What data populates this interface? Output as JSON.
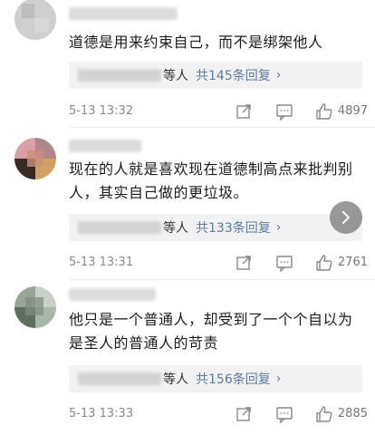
{
  "comments": [
    {
      "text_lines": [
        "道德是用来约束自己，而不是绑架他人"
      ],
      "reply_label": "等人",
      "reply_count": "共145条回复",
      "time": "5-13 13:32",
      "likes": "4897"
    },
    {
      "text_lines": [
        "现在的人就是喜欢现在道德制高点来批判别",
        "人，其实自己做的更垃圾。"
      ],
      "reply_label": "等人",
      "reply_count": "共133条回复",
      "time": "5-13 13:31",
      "likes": "2761"
    },
    {
      "text_lines": [
        "他只是一个普通人，却受到了一个个自以为",
        "是圣人的普通人的苛责"
      ],
      "reply_label": "等人",
      "reply_count": "共156条回复",
      "time": "5-13 13:33",
      "likes": "2885"
    }
  ],
  "icons": {
    "arrow": "›",
    "share": "share-icon",
    "comment": "comment-icon",
    "like": "thumbs-up-icon",
    "fab": "chevron-right-icon"
  }
}
